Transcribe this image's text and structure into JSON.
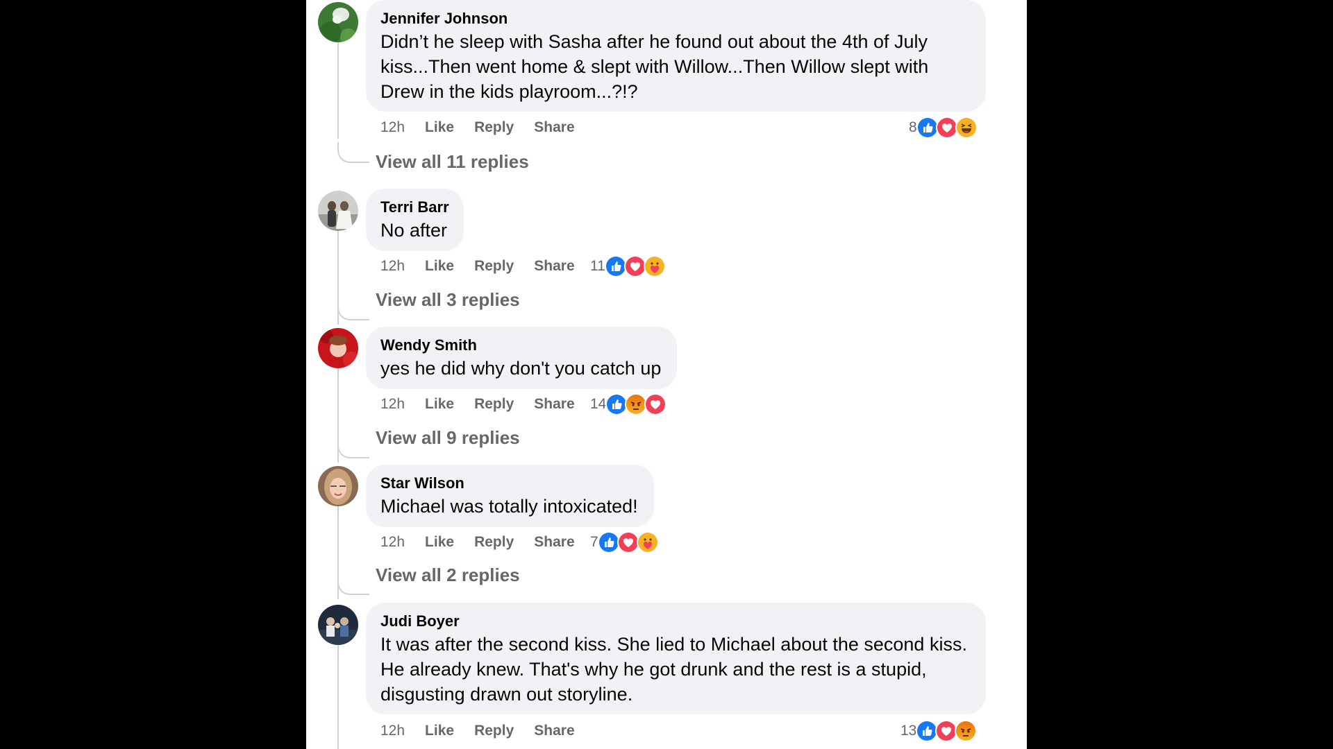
{
  "colors": {
    "like": "#1877f2",
    "love": "#f33e58",
    "haha": "#f7b125",
    "angry": "#e9710f",
    "care": "#f7b125",
    "muted_text": "#65676b",
    "bubble_bg": "#f0f2f5"
  },
  "actions": {
    "like": "Like",
    "reply": "Reply",
    "share": "Share"
  },
  "comments": [
    {
      "author": "Jennifer Johnson",
      "text_lines": [
        "Didn’t he sleep with Sasha after he found out about the 4th of July",
        "kiss...Then went home & slept with Willow...Then Willow slept with",
        "Drew in the kids playroom...?!?"
      ],
      "time": "12h",
      "reaction_count": "8",
      "reactions": [
        "like-icon",
        "love-icon",
        "haha-icon"
      ],
      "view_replies": "View all 11 replies"
    },
    {
      "author": "Terri Barr",
      "text_lines": [
        "No after"
      ],
      "time": "12h",
      "reaction_count": "11",
      "reactions": [
        "like-icon",
        "love-icon",
        "care-icon"
      ],
      "view_replies": "View all 3 replies"
    },
    {
      "author": "Wendy Smith",
      "text_lines": [
        "yes he did why don't you catch up"
      ],
      "time": "12h",
      "reaction_count": "14",
      "reactions": [
        "like-icon",
        "angry-icon",
        "love-icon"
      ],
      "view_replies": "View all 9 replies"
    },
    {
      "author": "Star Wilson",
      "text_lines": [
        "Michael was totally intoxicated!"
      ],
      "time": "12h",
      "reaction_count": "7",
      "reactions": [
        "like-icon",
        "love-icon",
        "care-icon"
      ],
      "view_replies": "View all 2 replies"
    },
    {
      "author": "Judi Boyer",
      "text_lines": [
        "It was after the second kiss. She lied to Michael about the second kiss.",
        "He already knew. That's why he got drunk and the rest is a stupid,",
        "disgusting drawn out storyline."
      ],
      "time": "12h",
      "reaction_count": "13",
      "reactions": [
        "like-icon",
        "love-icon",
        "angry-icon"
      ],
      "view_replies": ""
    }
  ]
}
